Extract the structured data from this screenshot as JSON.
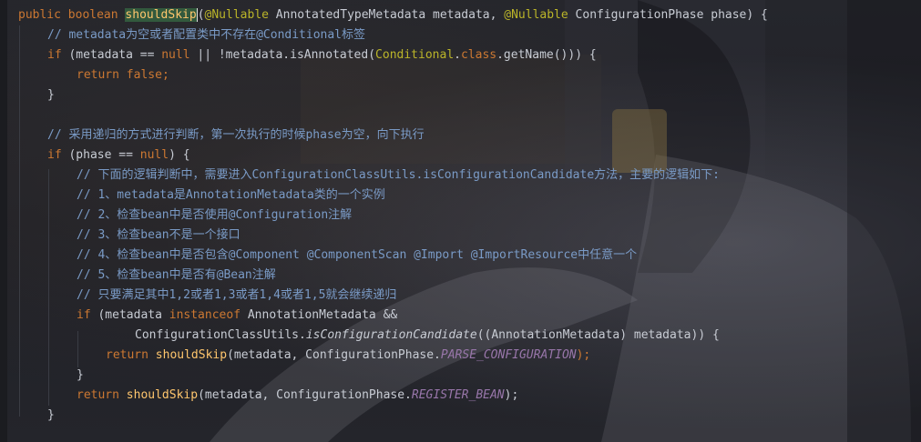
{
  "colors": {
    "keyword": "#cc7832",
    "annotation": "#bbb529",
    "comment": "#7a9bc7",
    "function": "#ffc66d",
    "constant": "#9876aa",
    "default_text": "#c8ccd4",
    "highlight_bg": "#32593d"
  },
  "code": {
    "l1": {
      "kw1": "public",
      "kw2": "boolean",
      "fn": "shouldSkip",
      "p1": "(",
      "ann1": "@Nullable",
      "t1": " AnnotatedTypeMetadata metadata, ",
      "ann2": "@Nullable",
      "t2": " ConfigurationPhase phase) {"
    },
    "l2": {
      "comment": "// metadata为空或者配置类中不存在@Conditional标签"
    },
    "l3": {
      "kw": "if",
      "t1": " (metadata == ",
      "kw2": "null",
      "t2": " || !metadata.isAnnotated(",
      "cls": "Conditional",
      "t3": ".",
      "kw3": "class",
      "t4": ".getName())) {"
    },
    "l4": {
      "kw": "return",
      "kw2": "false",
      "t": ";"
    },
    "l5": {
      "t": "}"
    },
    "l6": {
      "comment": "// 采用递归的方式进行判断，第一次执行的时候phase为空，向下执行"
    },
    "l7": {
      "kw": "if",
      "t1": " (phase == ",
      "kw2": "null",
      "t2": ") {"
    },
    "l8": {
      "comment": "// 下面的逻辑判断中，需要进入ConfigurationClassUtils.isConfigurationCandidate方法，主要的逻辑如下:"
    },
    "l9": {
      "comment": "// 1、metadata是AnnotationMetadata类的一个实例"
    },
    "l10": {
      "comment": "// 2、检查bean中是否使用@Configuration注解"
    },
    "l11": {
      "comment": "// 3、检查bean不是一个接口"
    },
    "l12": {
      "comment": "// 4、检查bean中是否包含@Component @ComponentScan @Import @ImportResource中任意一个"
    },
    "l13": {
      "comment": "// 5、检查bean中是否有@Bean注解"
    },
    "l14": {
      "comment": "// 只要满足其中1,2或者1,3或者1,4或者1,5就会继续递归"
    },
    "l15": {
      "kw": "if",
      "t1": " (metadata ",
      "kw2": "instanceof",
      "t2": " AnnotationMetadata &&"
    },
    "l16": {
      "t1": "ConfigurationClassUtils.",
      "it": "isConfigurationCandidate",
      "t2": "((AnnotationMetadata) metadata)) {"
    },
    "l17": {
      "kw": "return",
      "fn": "shouldSkip",
      "t1": "(metadata, ConfigurationPhase.",
      "const": "PARSE_CONFIGURATION",
      "t2": ");"
    },
    "l18": {
      "t": "}"
    },
    "l19": {
      "kw": "return",
      "fn": "shouldSkip",
      "t1": "(metadata, ConfigurationPhase.",
      "const": "REGISTER_BEAN",
      "t2": ");"
    },
    "l20": {
      "t": "}"
    }
  }
}
